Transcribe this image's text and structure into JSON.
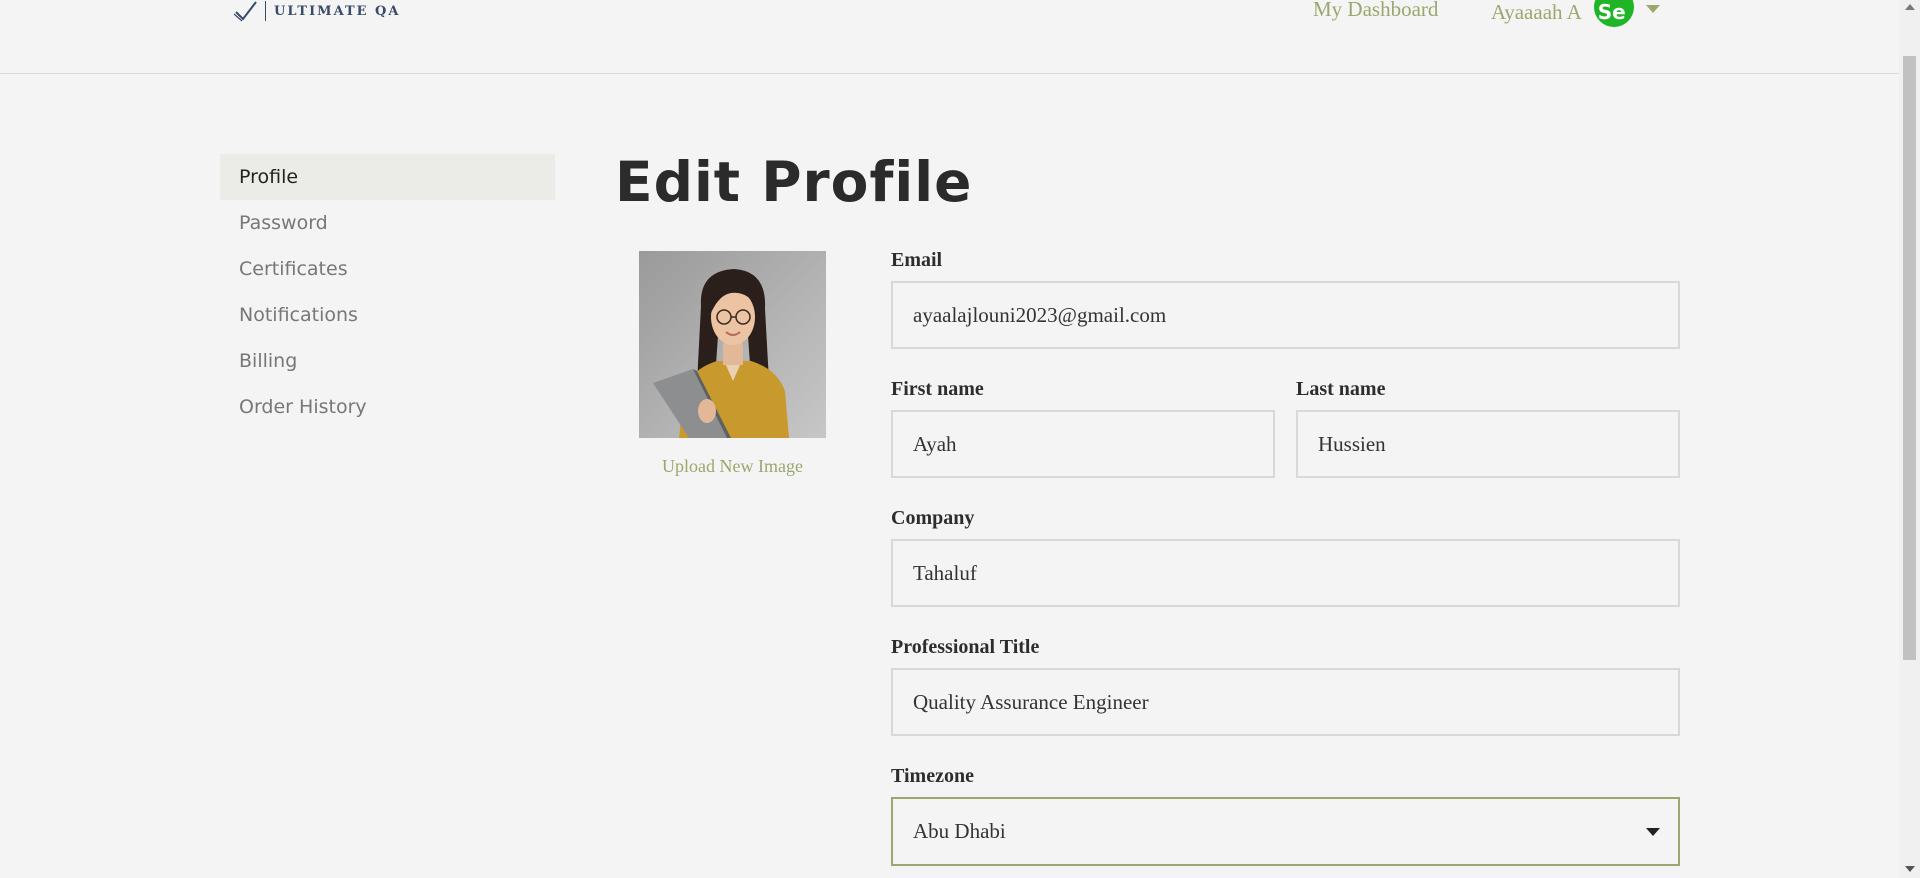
{
  "header": {
    "logo_text": "ULTIMATE QA",
    "dashboard_link": "My Dashboard",
    "user_name": "Ayaaaah A",
    "avatar_badge_text": "Se"
  },
  "sidebar": {
    "items": [
      {
        "label": "Profile",
        "active": true
      },
      {
        "label": "Password"
      },
      {
        "label": "Certificates"
      },
      {
        "label": "Notifications"
      },
      {
        "label": "Billing"
      },
      {
        "label": "Order History"
      }
    ]
  },
  "main": {
    "title": "Edit Profile",
    "upload_label": "Upload New Image",
    "fields": {
      "email": {
        "label": "Email",
        "value": "ayaalajlouni2023@gmail.com"
      },
      "first_name": {
        "label": "First name",
        "value": "Ayah"
      },
      "last_name": {
        "label": "Last name",
        "value": "Hussien"
      },
      "company": {
        "label": "Company",
        "value": "Tahaluf"
      },
      "professional_title": {
        "label": "Professional Title",
        "value": "Quality Assurance Engineer"
      },
      "timezone": {
        "label": "Timezone",
        "value": "Abu Dhabi"
      }
    }
  },
  "colors": {
    "accent": "#9aa86e",
    "logo": "#3a4a6b",
    "badge": "#1fb526",
    "background": "#f4f4f4"
  }
}
